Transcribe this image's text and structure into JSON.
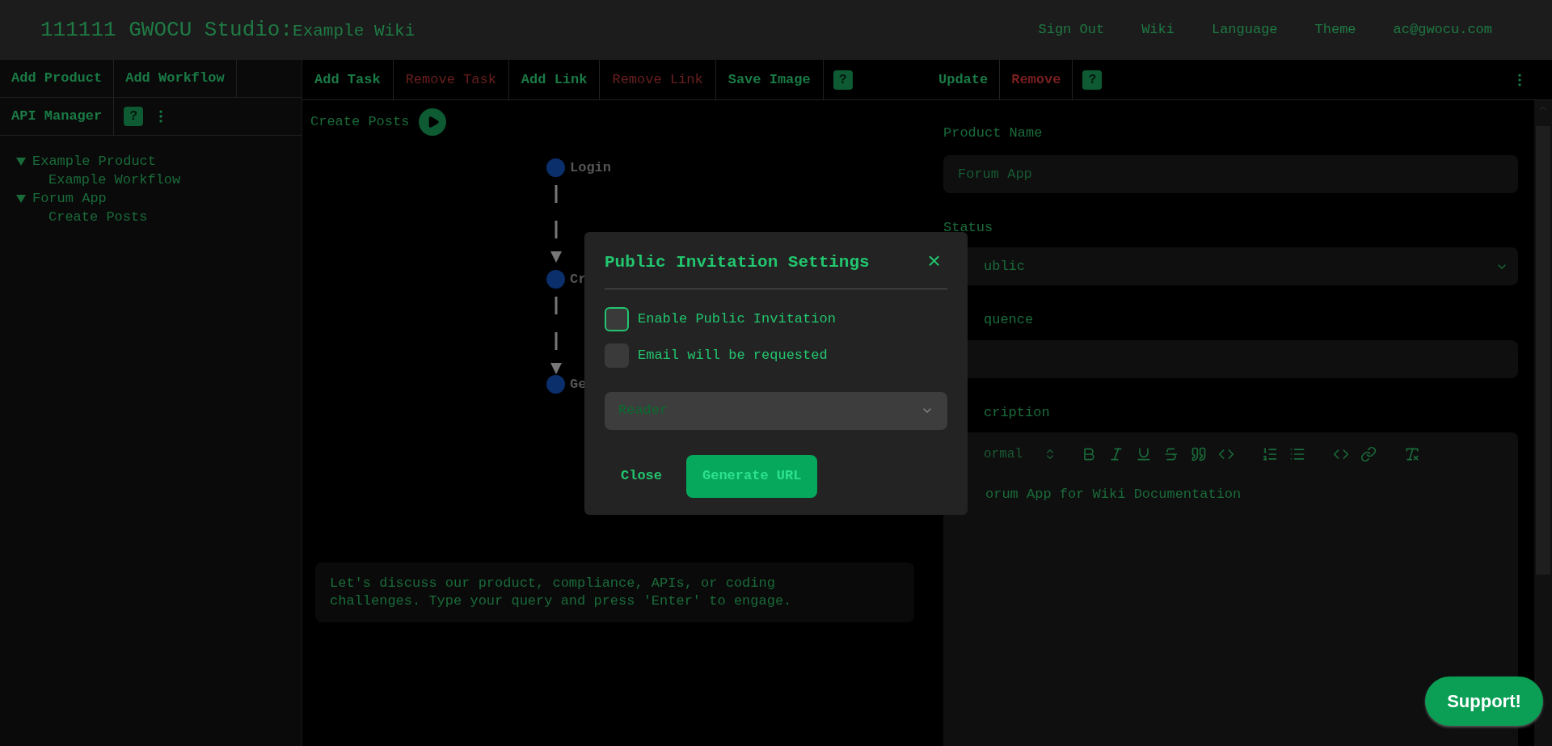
{
  "header": {
    "title": "111111 GWOCU Studio:",
    "subtitle": "Example Wiki",
    "links": [
      "Sign Out",
      "Wiki",
      "Language",
      "Theme",
      "ac@gwocu.com"
    ]
  },
  "left_panel": {
    "toolbar_rows": [
      [
        "Add Product",
        "Add Workflow"
      ],
      [
        "API Manager"
      ]
    ],
    "help": "?",
    "tree": [
      {
        "label": "Example Product",
        "expanded": true,
        "children": [
          {
            "label": "Example Workflow"
          }
        ]
      },
      {
        "label": "Forum App",
        "expanded": true,
        "children": [
          {
            "label": "Create Posts"
          }
        ]
      }
    ]
  },
  "workflow_panel": {
    "toolbar": [
      {
        "label": "Add Task",
        "kind": "normal"
      },
      {
        "label": "Remove Task",
        "kind": "danger"
      },
      {
        "label": "Add Link",
        "kind": "normal"
      },
      {
        "label": "Remove Link",
        "kind": "danger"
      },
      {
        "label": "Save Image",
        "kind": "normal"
      }
    ],
    "help": "?",
    "workflow_title": "Create Posts",
    "nodes": [
      {
        "label": "Login"
      },
      {
        "label": "Cr"
      },
      {
        "label": "Ge"
      }
    ],
    "chat_prompt": "Let's discuss our product, compliance, APIs, or coding challenges. Type your query and press 'Enter' to engage."
  },
  "details_panel": {
    "toolbar": [
      {
        "label": "Update",
        "kind": "normal"
      },
      {
        "label": "Remove",
        "kind": "danger"
      }
    ],
    "help": "?",
    "product_name_label": "Product Name",
    "product_name_placeholder": "Forum App",
    "status_label": "Status",
    "status_value": "ublic",
    "sequence_label": "quence",
    "description_label": "cription",
    "editor_style": "ormal",
    "description_text": "orum App for Wiki Documentation"
  },
  "dialog": {
    "title": "Public Invitation Settings",
    "close_icon": "×",
    "options": [
      {
        "label": "Enable Public Invitation",
        "checked": false,
        "focused": true
      },
      {
        "label": "Email will be requested",
        "checked": false,
        "focused": false
      }
    ],
    "role_value": "Reader",
    "buttons": [
      {
        "label": "Close",
        "kind": "text"
      },
      {
        "label": "Generate URL",
        "kind": "primary"
      }
    ]
  },
  "support_button": "Support!"
}
